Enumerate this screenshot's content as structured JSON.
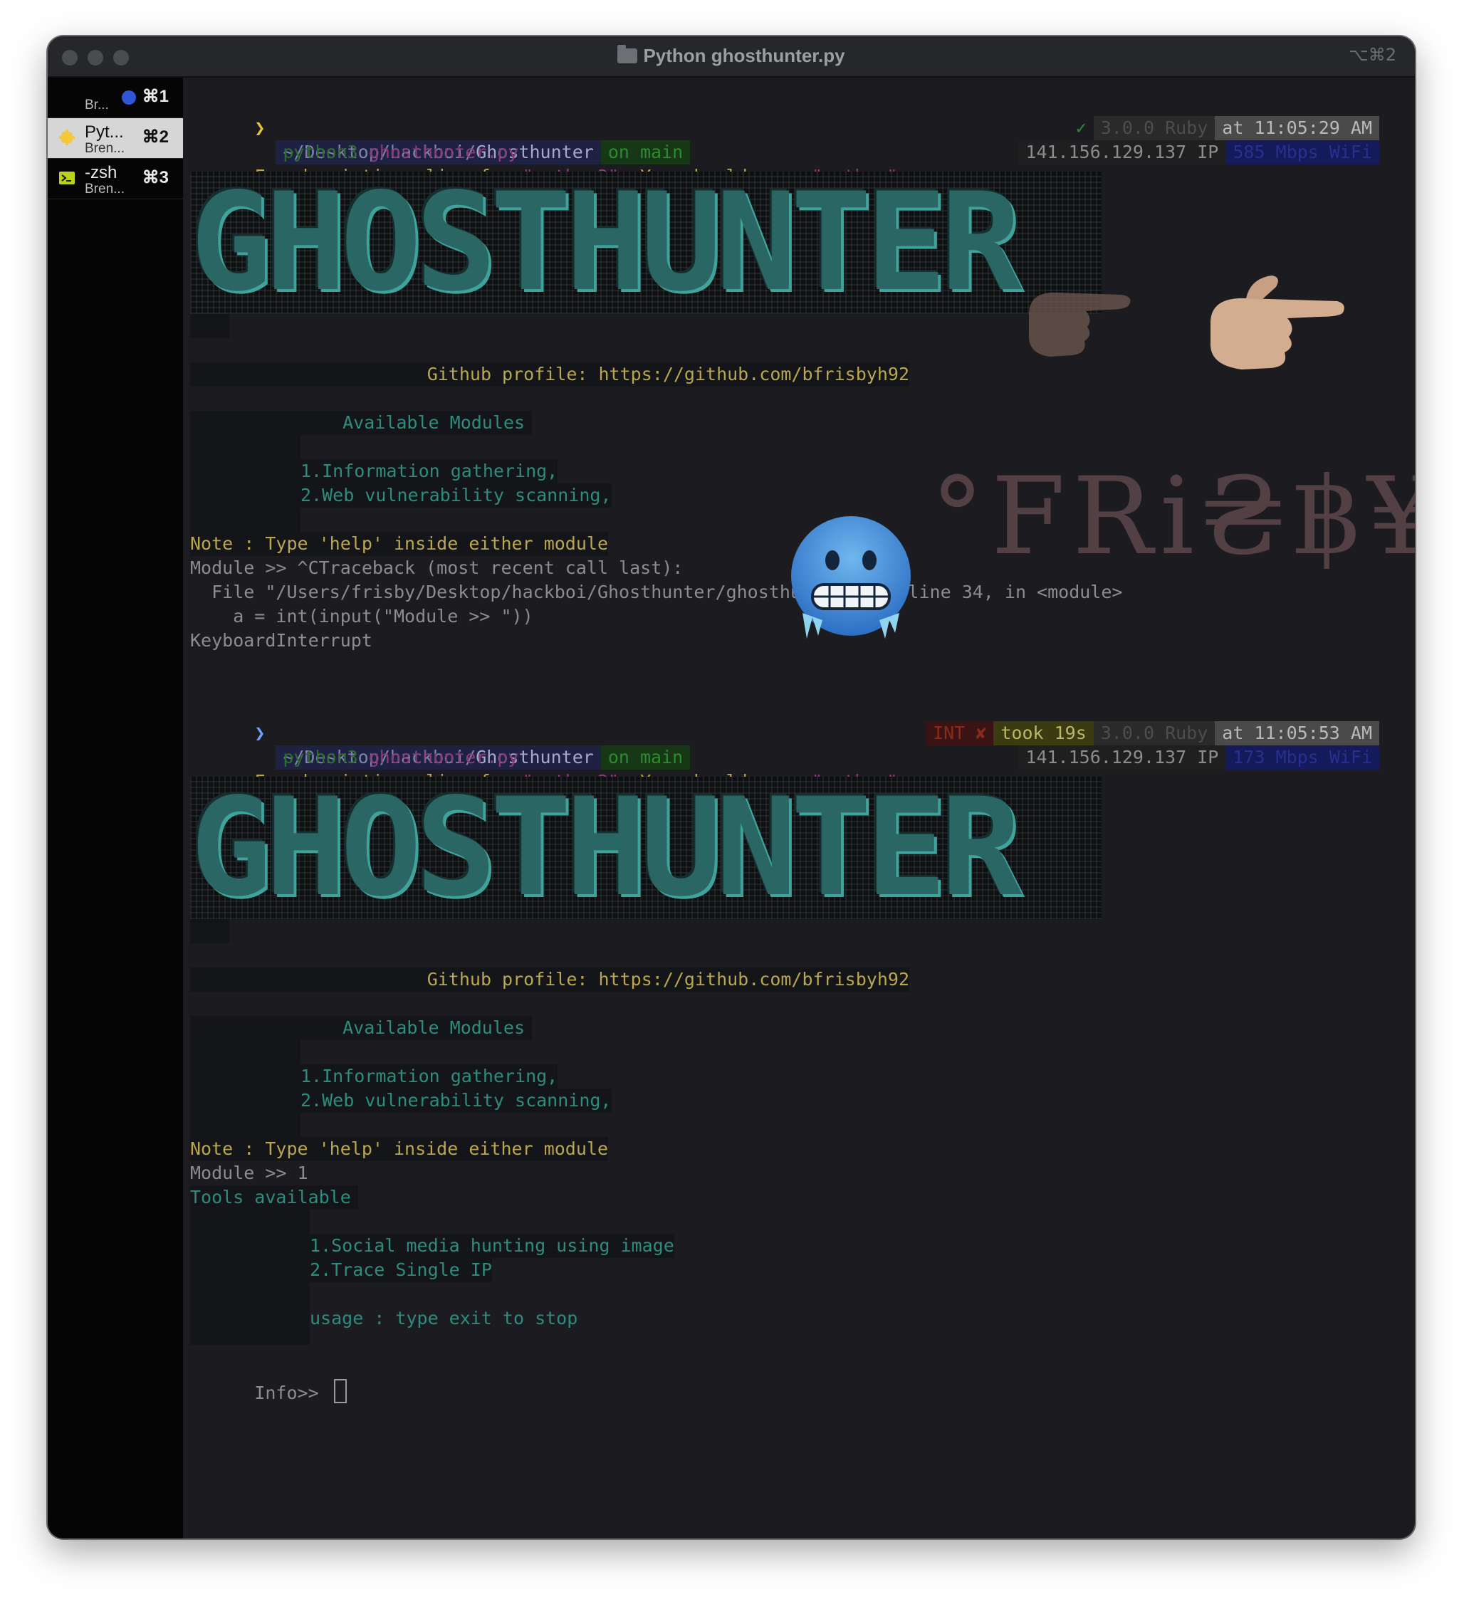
{
  "window": {
    "title": "Python ghosthunter.py",
    "shortcut": "⌥⌘2"
  },
  "tabs": [
    {
      "label": "",
      "sub": "Br...",
      "key": "⌘1"
    },
    {
      "label": "Pyt...",
      "sub": "Bren...",
      "key": "⌘2"
    },
    {
      "label": "-zsh",
      "sub": "Bren...",
      "key": "⌘3"
    }
  ],
  "session1": {
    "path_prefix": "~/Desktop/hackboi/",
    "path_dir": "Ghosthunter",
    "branch": "on main",
    "status_ok": "✓",
    "ruby": "3.0.0 Ruby",
    "time": "at 11:05:29 AM",
    "ip": "141.156.129.137 IP",
    "wifi": "585 Mbps WiFi",
    "cmd": "python3",
    "cmd_arg": "ghosthunter.py",
    "alias_prefix": "Found existing alias for ",
    "alias_py3": "\"python3\"",
    "alias_mid": ". You should use: ",
    "alias_py": "\"python\"",
    "banner": "GHOSTHUNTER",
    "github": "Github profile: https://github.com/bfrisbyh92",
    "modules_title": "Available Modules",
    "module1": "1.Information gathering,",
    "module2": "2.Web vulnerability scanning,",
    "note": "Note : Type 'help' inside either module",
    "prompt": "Module >> ^CTraceback (most recent call last):",
    "tb_file": "  File \"/Users/frisby/Desktop/hackboi/Ghosthunter/ghosthunter.py\", line 34, in <module>",
    "tb_line": "    a = int(input(\"Module >> \"))",
    "tb_error": "KeyboardInterrupt"
  },
  "session2": {
    "path_prefix": "~/Desktop/hackboi/",
    "path_dir": "Ghosthunter",
    "branch": "on main",
    "int": "INT ✘",
    "took": "took 19s",
    "ruby": "3.0.0 Ruby",
    "time": "at 11:05:53 AM",
    "ip": "141.156.129.137 IP",
    "wifi": "173 Mbps WiFi",
    "cmd": "python3",
    "cmd_arg": "ghosthunter.py",
    "alias_prefix": "Found existing alias for ",
    "alias_py3": "\"python3\"",
    "alias_mid": ". You should use: ",
    "alias_py": "\"python\"",
    "banner": "GHOSTHUNTER",
    "github": "Github profile: https://github.com/bfrisbyh92",
    "modules_title": "Available Modules",
    "module1": "1.Information gathering,",
    "module2": "2.Web vulnerability scanning,",
    "note": "Note : Type 'help' inside either module",
    "prompt": "Module >> 1",
    "tools_title": "Tools available",
    "tool1": "1.Social media hunting using image",
    "tool2": "2.Trace Single IP",
    "usage": "usage : type exit to stop",
    "info_prompt": "Info>> "
  },
  "overlay": {
    "signature": "°FRi₴฿¥"
  },
  "colors": {
    "background": "#1c1c20",
    "banner": "#2a6663",
    "accent_yellow": "#b9a64e",
    "accent_cyan": "#2e8c7e"
  }
}
